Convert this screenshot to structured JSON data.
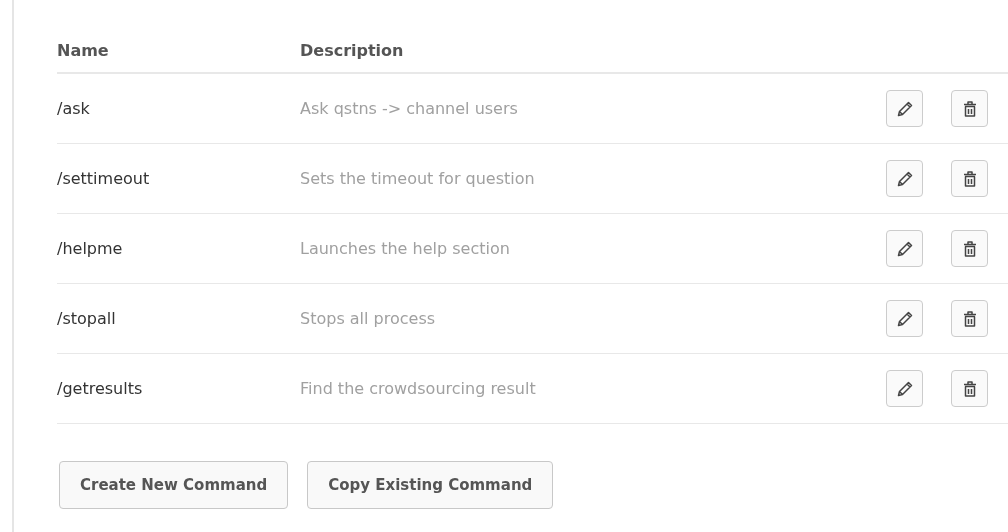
{
  "table": {
    "columns": [
      "Name",
      "Description"
    ],
    "rows": [
      {
        "name": "/ask",
        "description": "Ask qstns -> channel users"
      },
      {
        "name": "/settimeout",
        "description": "Sets the timeout for question"
      },
      {
        "name": "/helpme",
        "description": "Launches the help section"
      },
      {
        "name": "/stopall",
        "description": "Stops all process"
      },
      {
        "name": "/getresults",
        "description": "Find the crowdsourcing result"
      }
    ]
  },
  "buttons": [
    "Create New Command",
    "Copy Existing Command"
  ]
}
